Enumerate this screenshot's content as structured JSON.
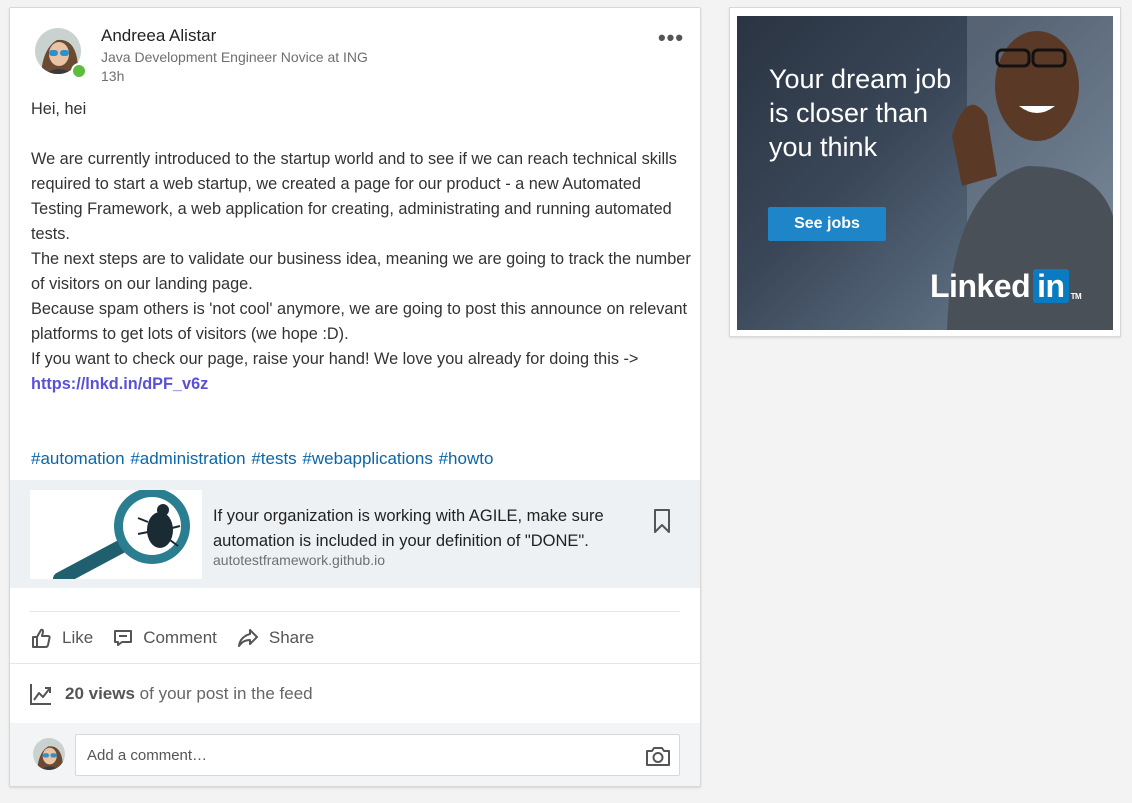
{
  "post": {
    "author_name": "Andreea Alistar",
    "author_headline": "Java Development Engineer Novice at ING",
    "time": "13h",
    "more_label": "•••",
    "body": {
      "greeting": "Hei, hei",
      "paragraph1": "We are currently introduced to the startup world and to see if we can reach technical skills required to start a web startup, we created a page for our product - a new Automated Testing Framework, a web application for creating, administrating and running automated tests.",
      "paragraph2": "The next steps are to validate our business idea, meaning we are going to track the number of visitors on our landing page.",
      "paragraph3": "Because spam others is 'not cool' anymore, we are going to post this announce on relevant platforms to get lots of visitors (we hope :D).",
      "paragraph4": "If you want to check our page, raise your hand! We love you already for doing this -> ",
      "link": "https://lnkd.in/dPF_v6z"
    },
    "hashtags": [
      "#automation",
      "#administration",
      "#tests",
      "#webapplications",
      "#howto"
    ],
    "preview": {
      "title": "If your organization is working with AGILE, make sure automation is included in your definition of \"DONE\".",
      "domain": "autotestframework.github.io"
    },
    "actions": {
      "like": "Like",
      "comment": "Comment",
      "share": "Share"
    },
    "views": {
      "count": "20 views",
      "suffix": " of your post in the feed"
    },
    "comment_placeholder": "Add a comment…"
  },
  "ad": {
    "headline": "Your dream job is closer than you think",
    "cta": "See jobs",
    "logo_text": "Linked",
    "logo_in": "in",
    "logo_tm": "TM"
  },
  "colors": {
    "presence": "#5ebd3e",
    "link": "#5a50d8",
    "hashtag": "#0a66a8",
    "cta": "#1e86c8"
  }
}
